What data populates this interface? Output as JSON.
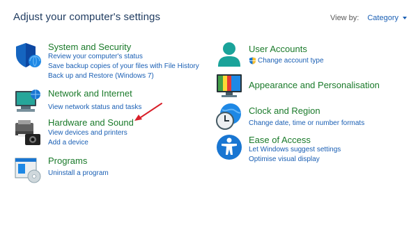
{
  "header": {
    "title": "Adjust your computer's settings",
    "view_by_label": "View by:",
    "view_by_value": "Category"
  },
  "categories_left": [
    {
      "title": "System and Security",
      "icon": "shield-icon",
      "links": [
        "Review your computer's status",
        "Save backup copies of your files with File History",
        "Back up and Restore (Windows 7)"
      ]
    },
    {
      "title": "Network and Internet",
      "icon": "network-globe-icon",
      "links": [
        "View network status and tasks"
      ]
    },
    {
      "title": "Hardware and Sound",
      "icon": "printer-camera-icon",
      "links": [
        "View devices and printers",
        "Add a device"
      ]
    },
    {
      "title": "Programs",
      "icon": "programs-disc-icon",
      "links": [
        "Uninstall a program"
      ]
    }
  ],
  "categories_right": [
    {
      "title": "User Accounts",
      "icon": "user-icon",
      "links": [
        "Change account type"
      ]
    },
    {
      "title": "Appearance and Personalisation",
      "icon": "monitor-icon",
      "links": []
    },
    {
      "title": "Clock and Region",
      "icon": "clock-globe-icon",
      "links": [
        "Change date, time or number formats"
      ]
    },
    {
      "title": "Ease of Access",
      "icon": "accessibility-icon",
      "links": [
        "Let Windows suggest settings",
        "Optimise visual display"
      ]
    }
  ],
  "colors": {
    "title_green": "#1a7a2a",
    "link_blue": "#1a5fb4",
    "arrow_red": "#d9202a"
  }
}
